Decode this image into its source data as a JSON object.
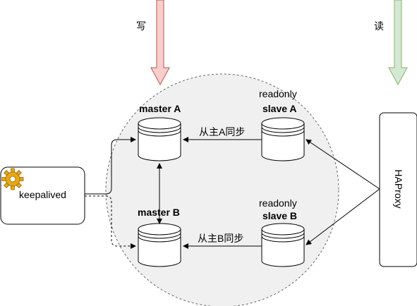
{
  "labels": {
    "write": "写",
    "read": "读",
    "master_a": "master A",
    "master_b": "master B",
    "readonly_a": "readonly",
    "slave_a": "slave A",
    "readonly_b": "readonly",
    "slave_b": "slave B",
    "sync_a": "从主A同步",
    "sync_b": "从主B同步",
    "keepalived": "keepalived",
    "haproxy": "HAProxy"
  },
  "icons": [
    "gear-icon",
    "database-cylinder-icon",
    "arrow-down-icon"
  ],
  "colors": {
    "write_arrow_fill": "#f8cecc",
    "write_arrow_stroke": "#b85450",
    "read_arrow_fill": "#d5e8d4",
    "read_arrow_stroke": "#82b366",
    "cluster_fill": "#f0f0f0",
    "gear": "#e6a817"
  }
}
